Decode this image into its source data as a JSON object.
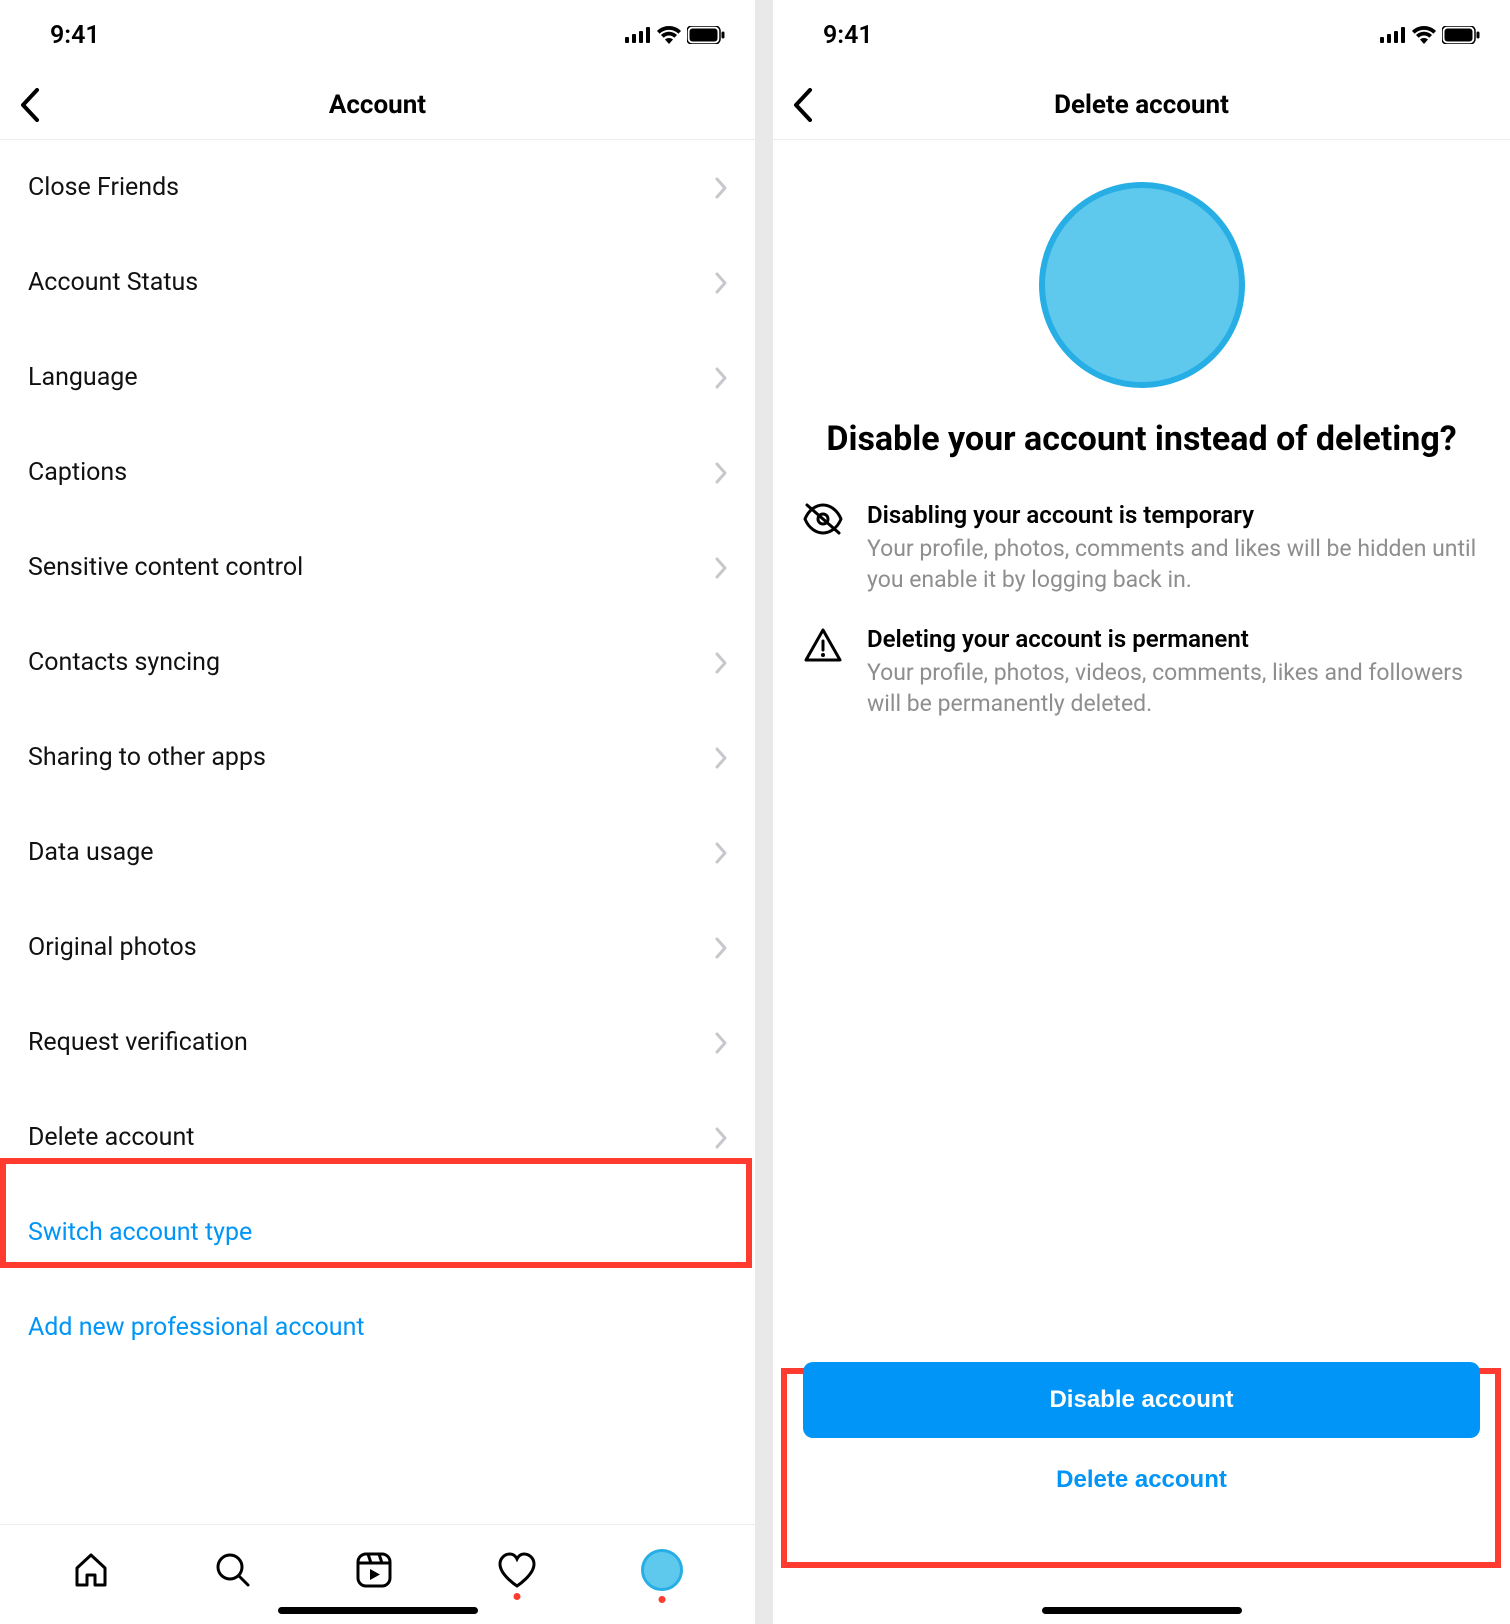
{
  "status": {
    "time": "9:41"
  },
  "left": {
    "title": "Account",
    "items": [
      "Close Friends",
      "Account Status",
      "Language",
      "Captions",
      "Sensitive content control",
      "Contacts syncing",
      "Sharing to other apps",
      "Data usage",
      "Original photos",
      "Request verification",
      "Delete account"
    ],
    "links": [
      "Switch account type",
      "Add new professional account"
    ]
  },
  "right": {
    "title": "Delete account",
    "hero": "Disable your account instead of deleting?",
    "info": [
      {
        "title": "Disabling your account is temporary",
        "body": "Your profile, photos, comments and likes will be hidden until you enable it by logging back in."
      },
      {
        "title": "Deleting your account is permanent",
        "body": "Your profile, photos, videos, comments, likes and followers will be permanently deleted."
      }
    ],
    "primary": "Disable account",
    "secondary": "Delete account"
  }
}
